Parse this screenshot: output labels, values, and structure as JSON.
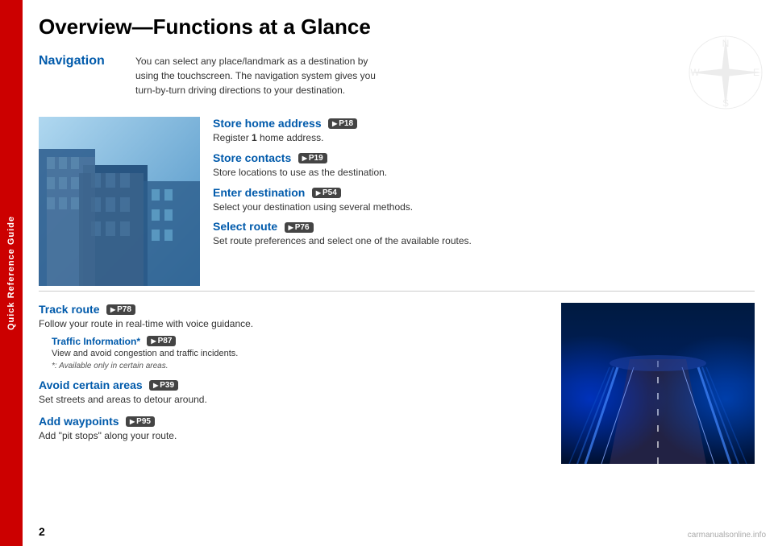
{
  "page": {
    "title": "Overview—Functions at a Glance",
    "page_number": "2",
    "side_tab": "Quick Reference Guide"
  },
  "navigation": {
    "label": "Navigation",
    "description": "You can select any place/landmark as a destination by using the touchscreen. The navigation system gives you turn-by-turn driving directions to your destination."
  },
  "features_top": [
    {
      "title": "Store home address",
      "badge": "P18",
      "description": "Register 1 home address."
    },
    {
      "title": "Store contacts",
      "badge": "P19",
      "description": "Store locations to use as the destination."
    },
    {
      "title": "Enter destination",
      "badge": "P54",
      "description": "Select your destination using several methods."
    },
    {
      "title": "Select route",
      "badge": "P76",
      "description": "Set route preferences and select one of the available routes."
    }
  ],
  "features_bottom": [
    {
      "title": "Track route",
      "badge": "P78",
      "description": "Follow your route in real-time with voice guidance.",
      "sub": {
        "title": "Traffic Information*",
        "badge": "P87",
        "description": "View and avoid congestion and traffic incidents.",
        "note": "*: Available only in certain areas."
      }
    },
    {
      "title": "Avoid certain areas",
      "badge": "P39",
      "description": "Set streets and areas to detour around."
    },
    {
      "title": "Add waypoints",
      "badge": "P95",
      "description": "Add “pit stops” along your route."
    }
  ],
  "watermark": "carmanualsonline.info"
}
